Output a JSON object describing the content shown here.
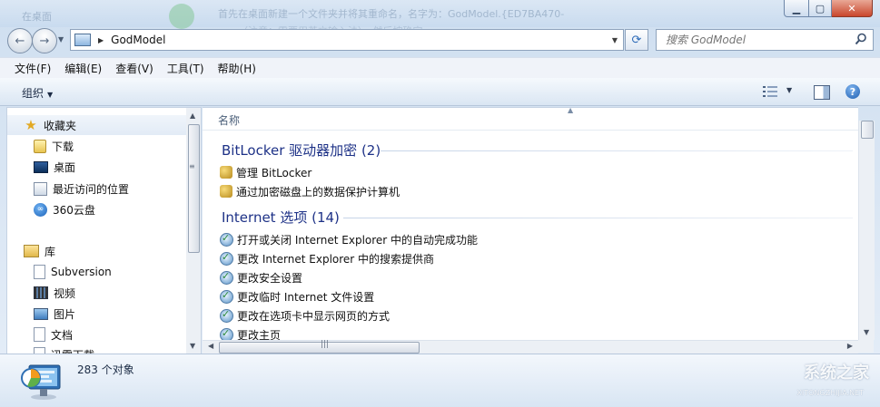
{
  "window": {
    "address_path": "GodModel",
    "search_placeholder": "搜索 GodModel",
    "background_text_1": "在桌面",
    "background_text_2": "首先在桌面新建一个文件夹并将其重命名，名字为：GodModel.{ED7BA470-",
    "background_text_3": "……（注意：需要用英文输入法），然后按确定。"
  },
  "menu": [
    "文件(F)",
    "编辑(E)",
    "查看(V)",
    "工具(T)",
    "帮助(H)"
  ],
  "toolbar": {
    "organize_label": "组织"
  },
  "nav": {
    "favorites": {
      "label": "收藏夹",
      "items": [
        "下载",
        "桌面",
        "最近访问的位置",
        "360云盘"
      ]
    },
    "library": {
      "label": "库",
      "items": [
        "Subversion",
        "视频",
        "图片",
        "文档",
        "迅雷下载"
      ]
    }
  },
  "content": {
    "column_name": "名称",
    "groups": [
      {
        "title": "BitLocker 驱动器加密 (2)",
        "items": [
          "管理 BitLocker",
          "通过加密磁盘上的数据保护计算机"
        ]
      },
      {
        "title": "Internet 选项 (14)",
        "items": [
          "打开或关闭 Internet Explorer 中的自动完成功能",
          "更改 Internet Explorer 中的搜索提供商",
          "更改安全设置",
          "更改临时 Internet 文件设置",
          "更改在选项卡中显示网页的方式",
          "更改主页"
        ]
      }
    ]
  },
  "status": {
    "item_count": "283 个对象"
  },
  "watermark": {
    "brand": "系统之家",
    "site": "XITONGZHIJIA.NET"
  },
  "colors": {
    "group_title": "#1e3287",
    "accent": "#2e6bb8"
  }
}
